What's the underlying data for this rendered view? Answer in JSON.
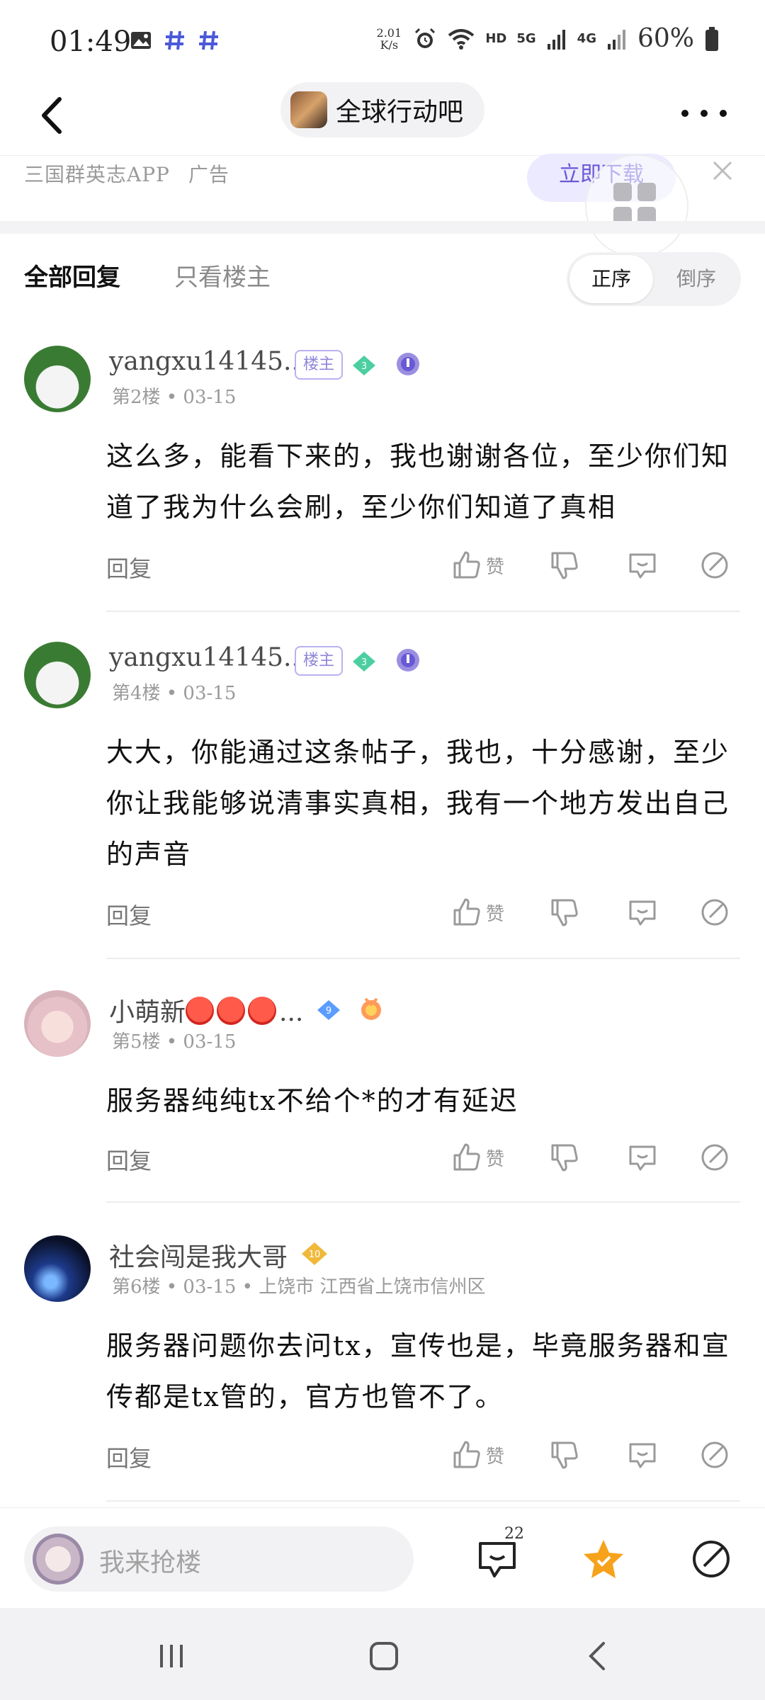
{
  "status_bar": {
    "time": "01:49",
    "net_speed_value": "2.01",
    "net_speed_unit": "K/s",
    "hd_label": "HD",
    "sig_5g": "5G",
    "sig_4g": "4G",
    "battery": "60%"
  },
  "header": {
    "forum_name": "全球行动吧"
  },
  "ad": {
    "source": "三国群英志APP",
    "tag": "广告",
    "download_label": "立即下载"
  },
  "tabs": {
    "all_replies": "全部回复",
    "only_op": "只看楼主",
    "sort_asc": "正序",
    "sort_desc": "倒序"
  },
  "posts": [
    {
      "username": "yangxu14145...",
      "host_badge": "楼主",
      "level": "3",
      "floor": "第2楼",
      "date": "03-15",
      "location": "",
      "content": "这么多，能看下来的，我也谢谢各位，至少你们知道了我为什么会刷，至少你们知道了真相",
      "reply_label": "回复",
      "like_label": "赞"
    },
    {
      "username": "yangxu14145...",
      "host_badge": "楼主",
      "level": "3",
      "floor": "第4楼",
      "date": "03-15",
      "location": "",
      "content": "大大，你能通过这条帖子，我也，十分感谢，至少你让我能够说清事实真相，我有一个地方发出自己的声音",
      "reply_label": "回复",
      "like_label": "赞"
    },
    {
      "username": "小萌新",
      "username_suffix": "...",
      "level": "9",
      "floor": "第5楼",
      "date": "03-15",
      "location": "",
      "content": "服务器纯纯tx不给个*的才有延迟",
      "reply_label": "回复",
      "like_label": "赞"
    },
    {
      "username": "社会闯是我大哥",
      "level": "10",
      "floor": "第6楼",
      "date": "03-15",
      "location": "上饶市 江西省上饶市信州区",
      "content": "服务器问题你去问tx，宣传也是，毕竟服务器和宣传都是tx管的，官方也管不了。",
      "reply_label": "回复",
      "like_label": "赞"
    }
  ],
  "bottom_bar": {
    "input_placeholder": "我来抢楼",
    "comment_count": "22"
  },
  "colors": {
    "accent_purple": "#6a59d6",
    "star_orange": "#f7a21b",
    "badge_green": "#4ccfa0",
    "badge_blue": "#5a9cff",
    "badge_gold": "#f0b93a"
  }
}
